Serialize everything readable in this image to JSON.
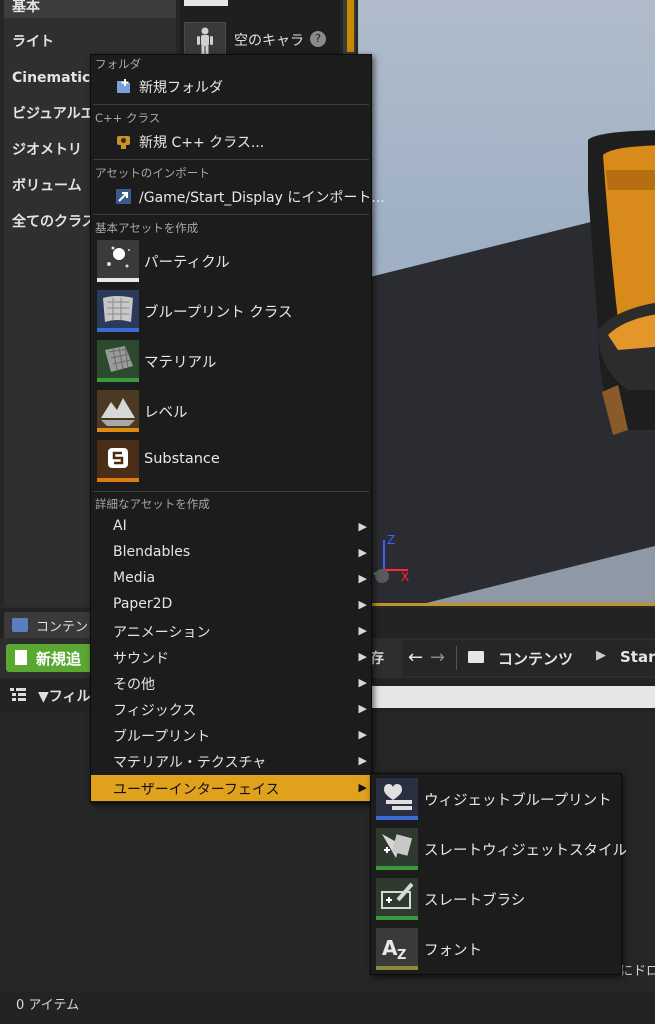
{
  "modes_panel": {
    "items": [
      {
        "label": "基本",
        "selected": true
      },
      {
        "label": "ライト",
        "selected": false
      },
      {
        "label": "Cinematic",
        "selected": false
      },
      {
        "label": "ビジュアルエ",
        "selected": false
      },
      {
        "label": "ジオメトリ",
        "selected": false
      },
      {
        "label": "ボリューム",
        "selected": false
      },
      {
        "label": "全てのクラス",
        "selected": false
      }
    ],
    "empty_character_label": "空のキャラ",
    "help_icon": "?"
  },
  "viewport": {
    "gizmo_z": "Z",
    "gizmo_x": "X"
  },
  "content_browser": {
    "tab_label": "コンテンツ",
    "add_new_label": "新規追",
    "save_fragment": "存",
    "back_icon": "←",
    "forward_icon": "→",
    "path_content": "コンテンツ",
    "path_separator": "▶",
    "path_start": "Start",
    "filter_label": "フィル",
    "drop_hint": "にドロ",
    "item_count": "0 アイテム"
  },
  "context_menu": {
    "folder_header": "フォルダ",
    "new_folder": "新規フォルダ",
    "cpp_header": "C++ クラス",
    "new_cpp_class": "新規 C++ クラス...",
    "import_header": "アセットのインポート",
    "import_to": "/Game/Start_Display にインポート...",
    "basic_header": "基本アセットを作成",
    "basic_assets": [
      {
        "label": "パーティクル",
        "icon": "particle-icon",
        "color": "#e8e8e8"
      },
      {
        "label": "ブループリント クラス",
        "icon": "blueprint-class-icon",
        "color": "#3a6ad4"
      },
      {
        "label": "マテリアル",
        "icon": "material-icon",
        "color": "#3a9a3a"
      },
      {
        "label": "レベル",
        "icon": "level-icon",
        "color": "#e08a10"
      },
      {
        "label": "Substance",
        "icon": "substance-icon",
        "color": "#e07a10"
      }
    ],
    "advanced_header": "詳細なアセットを作成",
    "advanced_items": [
      "AI",
      "Blendables",
      "Media",
      "Paper2D",
      "アニメーション",
      "サウンド",
      "その他",
      "フィジックス",
      "ブループリント",
      "マテリアル・テクスチャ",
      "ユーザーインターフェイス"
    ],
    "highlighted_item": "ユーザーインターフェイス",
    "submenu_arrow": "▶"
  },
  "submenu": {
    "items": [
      {
        "label": "ウィジェットブループリント",
        "icon": "widget-blueprint-icon",
        "color": "#3a6ad4"
      },
      {
        "label": "スレートウィジェットスタイル",
        "icon": "slate-widget-style-icon",
        "color": "#3a9a3a"
      },
      {
        "label": "スレートブラシ",
        "icon": "slate-brush-icon",
        "color": "#3a9a3a"
      },
      {
        "label": "フォント",
        "icon": "font-icon",
        "color": "#8a8a3a"
      }
    ]
  }
}
